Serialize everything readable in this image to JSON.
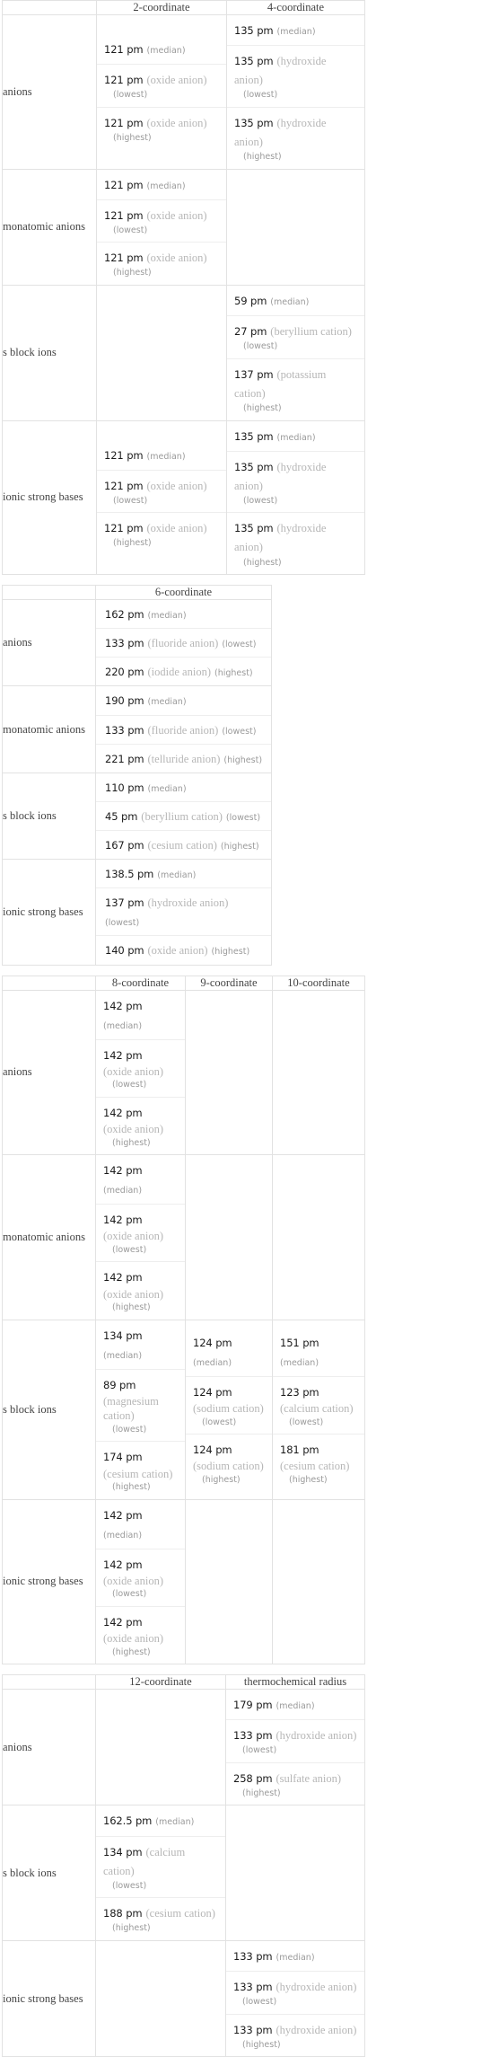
{
  "tables": [
    {
      "id": "t1",
      "columns": [
        "",
        "2-coordinate",
        "4-coordinate"
      ],
      "rows": [
        {
          "label": "anions",
          "cells": [
            [
              {
                "value": "121 pm",
                "species": "",
                "qual": "(median)",
                "style": "inline"
              },
              {
                "value": "121 pm",
                "species": "(oxide anion)",
                "qual": "(lowest)",
                "style": "below"
              },
              {
                "value": "121 pm",
                "species": "(oxide anion)",
                "qual": "(highest)",
                "style": "below"
              }
            ],
            [
              {
                "value": "135 pm",
                "species": "",
                "qual": "(median)",
                "style": "inline"
              },
              {
                "value": "135 pm",
                "species": "(hydroxide anion)",
                "qual": "(lowest)",
                "style": "below"
              },
              {
                "value": "135 pm",
                "species": "(hydroxide anion)",
                "qual": "(highest)",
                "style": "below"
              }
            ]
          ]
        },
        {
          "label": "monatomic anions",
          "cells": [
            [
              {
                "value": "121 pm",
                "species": "",
                "qual": "(median)",
                "style": "inline"
              },
              {
                "value": "121 pm",
                "species": "(oxide anion)",
                "qual": "(lowest)",
                "style": "below"
              },
              {
                "value": "121 pm",
                "species": "(oxide anion)",
                "qual": "(highest)",
                "style": "below"
              }
            ],
            []
          ]
        },
        {
          "label": "s block ions",
          "cells": [
            [],
            [
              {
                "value": "59 pm",
                "species": "",
                "qual": "(median)",
                "style": "inline"
              },
              {
                "value": "27 pm",
                "species": "(beryllium cation)",
                "qual": "(lowest)",
                "style": "below"
              },
              {
                "value": "137 pm",
                "species": "(potassium cation)",
                "qual": "(highest)",
                "style": "below"
              }
            ]
          ]
        },
        {
          "label": "ionic strong bases",
          "cells": [
            [
              {
                "value": "121 pm",
                "species": "",
                "qual": "(median)",
                "style": "inline"
              },
              {
                "value": "121 pm",
                "species": "(oxide anion)",
                "qual": "(lowest)",
                "style": "below"
              },
              {
                "value": "121 pm",
                "species": "(oxide anion)",
                "qual": "(highest)",
                "style": "below"
              }
            ],
            [
              {
                "value": "135 pm",
                "species": "",
                "qual": "(median)",
                "style": "inline"
              },
              {
                "value": "135 pm",
                "species": "(hydroxide anion)",
                "qual": "(lowest)",
                "style": "below"
              },
              {
                "value": "135 pm",
                "species": "(hydroxide anion)",
                "qual": "(highest)",
                "style": "below"
              }
            ]
          ]
        }
      ]
    },
    {
      "id": "t2",
      "columns": [
        "",
        "6-coordinate"
      ],
      "rows": [
        {
          "label": "anions",
          "cells": [
            [
              {
                "value": "162 pm",
                "species": "",
                "qual": "(median)",
                "style": "inline"
              },
              {
                "value": "133 pm",
                "species": "(fluoride anion)",
                "qual": "(lowest)",
                "style": "inline"
              },
              {
                "value": "220 pm",
                "species": "(iodide anion)",
                "qual": "(highest)",
                "style": "inline"
              }
            ]
          ]
        },
        {
          "label": "monatomic anions",
          "cells": [
            [
              {
                "value": "190 pm",
                "species": "",
                "qual": "(median)",
                "style": "inline"
              },
              {
                "value": "133 pm",
                "species": "(fluoride anion)",
                "qual": "(lowest)",
                "style": "inline"
              },
              {
                "value": "221 pm",
                "species": "(telluride anion)",
                "qual": "(highest)",
                "style": "inline"
              }
            ]
          ]
        },
        {
          "label": "s block ions",
          "cells": [
            [
              {
                "value": "110 pm",
                "species": "",
                "qual": "(median)",
                "style": "inline"
              },
              {
                "value": "45 pm",
                "species": "(beryllium cation)",
                "qual": "(lowest)",
                "style": "inline"
              },
              {
                "value": "167 pm",
                "species": "(cesium cation)",
                "qual": "(highest)",
                "style": "inline"
              }
            ]
          ]
        },
        {
          "label": "ionic strong bases",
          "cells": [
            [
              {
                "value": "138.5 pm",
                "species": "",
                "qual": "(median)",
                "style": "inline"
              },
              {
                "value": "137 pm",
                "species": "(hydroxide anion)",
                "qual": "(lowest)",
                "style": "inline"
              },
              {
                "value": "140 pm",
                "species": "(oxide anion)",
                "qual": "(highest)",
                "style": "inline"
              }
            ]
          ]
        }
      ]
    },
    {
      "id": "t3",
      "columns": [
        "",
        "8-coordinate",
        "9-coordinate",
        "10-coordinate"
      ],
      "rows": [
        {
          "label": "anions",
          "cells": [
            [
              {
                "value": "142 pm",
                "species": "",
                "qual": "(median)",
                "style": "inline"
              },
              {
                "value": "142 pm",
                "species": "(oxide anion)",
                "qual": "(lowest)",
                "style": "below"
              },
              {
                "value": "142 pm",
                "species": "(oxide anion)",
                "qual": "(highest)",
                "style": "below"
              }
            ],
            [],
            []
          ]
        },
        {
          "label": "monatomic anions",
          "cells": [
            [
              {
                "value": "142 pm",
                "species": "",
                "qual": "(median)",
                "style": "inline"
              },
              {
                "value": "142 pm",
                "species": "(oxide anion)",
                "qual": "(lowest)",
                "style": "below"
              },
              {
                "value": "142 pm",
                "species": "(oxide anion)",
                "qual": "(highest)",
                "style": "below"
              }
            ],
            [],
            []
          ]
        },
        {
          "label": "s block ions",
          "cells": [
            [
              {
                "value": "134 pm",
                "species": "",
                "qual": "(median)",
                "style": "inline"
              },
              {
                "value": "89 pm",
                "species": "(magnesium cation)",
                "qual": "(lowest)",
                "style": "below"
              },
              {
                "value": "174 pm",
                "species": "(cesium cation)",
                "qual": "(highest)",
                "style": "below"
              }
            ],
            [
              {
                "value": "124 pm",
                "species": "",
                "qual": "(median)",
                "style": "inline"
              },
              {
                "value": "124 pm",
                "species": "(sodium cation)",
                "qual": "(lowest)",
                "style": "below"
              },
              {
                "value": "124 pm",
                "species": "(sodium cation)",
                "qual": "(highest)",
                "style": "below"
              }
            ],
            [
              {
                "value": "151 pm",
                "species": "",
                "qual": "(median)",
                "style": "inline"
              },
              {
                "value": "123 pm",
                "species": "(calcium cation)",
                "qual": "(lowest)",
                "style": "below"
              },
              {
                "value": "181 pm",
                "species": "(cesium cation)",
                "qual": "(highest)",
                "style": "below"
              }
            ]
          ]
        },
        {
          "label": "ionic strong bases",
          "cells": [
            [
              {
                "value": "142 pm",
                "species": "",
                "qual": "(median)",
                "style": "inline"
              },
              {
                "value": "142 pm",
                "species": "(oxide anion)",
                "qual": "(lowest)",
                "style": "below"
              },
              {
                "value": "142 pm",
                "species": "(oxide anion)",
                "qual": "(highest)",
                "style": "below"
              }
            ],
            [],
            []
          ]
        }
      ]
    },
    {
      "id": "t4",
      "columns": [
        "",
        "12-coordinate",
        "thermochemical radius"
      ],
      "rows": [
        {
          "label": "anions",
          "cells": [
            [],
            [
              {
                "value": "179 pm",
                "species": "",
                "qual": "(median)",
                "style": "inline"
              },
              {
                "value": "133 pm",
                "species": "(hydroxide anion)",
                "qual": "(lowest)",
                "style": "below"
              },
              {
                "value": "258 pm",
                "species": "(sulfate anion)",
                "qual": "(highest)",
                "style": "below"
              }
            ]
          ]
        },
        {
          "label": "s block ions",
          "cells": [
            [
              {
                "value": "162.5 pm",
                "species": "",
                "qual": "(median)",
                "style": "inline"
              },
              {
                "value": "134 pm",
                "species": "(calcium cation)",
                "qual": "(lowest)",
                "style": "below"
              },
              {
                "value": "188 pm",
                "species": "(cesium cation)",
                "qual": "(highest)",
                "style": "below"
              }
            ],
            []
          ]
        },
        {
          "label": "ionic strong bases",
          "cells": [
            [],
            [
              {
                "value": "133 pm",
                "species": "",
                "qual": "(median)",
                "style": "inline"
              },
              {
                "value": "133 pm",
                "species": "(hydroxide anion)",
                "qual": "(lowest)",
                "style": "below"
              },
              {
                "value": "133 pm",
                "species": "(hydroxide anion)",
                "qual": "(highest)",
                "style": "below"
              }
            ]
          ]
        }
      ]
    }
  ]
}
